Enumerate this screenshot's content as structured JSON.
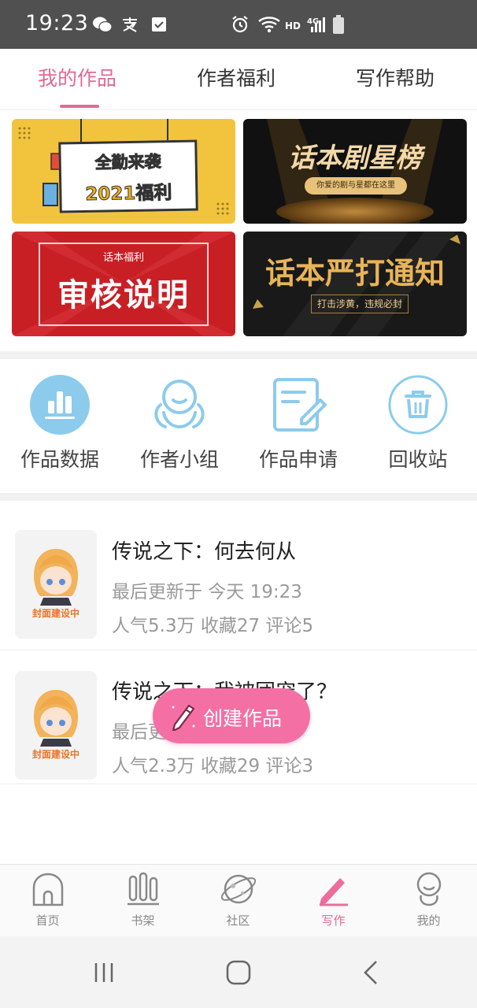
{
  "status_bar": {
    "time": "19:23",
    "icons": [
      "wechat-icon",
      "alipay-icon",
      "check-box-icon",
      "alarm-icon",
      "wifi-icon",
      "signal-icon",
      "battery-icon"
    ],
    "hd": "HD",
    "network": "4G"
  },
  "tabs": [
    {
      "label": "我的作品",
      "active": true
    },
    {
      "label": "作者福利",
      "active": false
    },
    {
      "label": "写作帮助",
      "active": false
    }
  ],
  "banners": {
    "b1": {
      "line1": "全勤来袭",
      "line2": "2021福利"
    },
    "b2": {
      "title": "话本剧星榜",
      "subtitle": "你爱的剧与星都在这里"
    },
    "b3": {
      "caption": "话本福利",
      "title": "审核说明"
    },
    "b4": {
      "title": "话本严打通知",
      "subtitle": "打击涉黄，违规必封"
    }
  },
  "quick_actions": [
    {
      "label": "作品数据",
      "icon": "bar-chart-icon"
    },
    {
      "label": "作者小组",
      "icon": "group-icon"
    },
    {
      "label": "作品申请",
      "icon": "edit-form-icon"
    },
    {
      "label": "回收站",
      "icon": "trash-icon"
    }
  ],
  "works": [
    {
      "title": "传说之下：何去何从",
      "updated": "最后更新于 今天 19:23",
      "stats": "人气5.3万 收藏27 评论5",
      "cover_label": "封面建设中"
    },
    {
      "title": "传说之下：我被团宠了？",
      "updated": "最后更新于 今天 19:23",
      "stats": "人气2.3万 收藏29 评论3",
      "cover_label": "封面建设中"
    }
  ],
  "fab": {
    "label": "创建作品",
    "icon": "pencil-icon"
  },
  "bottom_nav": [
    {
      "label": "首页",
      "icon": "home-icon",
      "active": false
    },
    {
      "label": "书架",
      "icon": "bookshelf-icon",
      "active": false
    },
    {
      "label": "社区",
      "icon": "planet-icon",
      "active": false
    },
    {
      "label": "写作",
      "icon": "pencil-icon",
      "active": true
    },
    {
      "label": "我的",
      "icon": "profile-icon",
      "active": false
    }
  ],
  "colors": {
    "accent": "#e06a93",
    "fab": "#f46fa4",
    "icon_blue": "#7ec5e8"
  }
}
